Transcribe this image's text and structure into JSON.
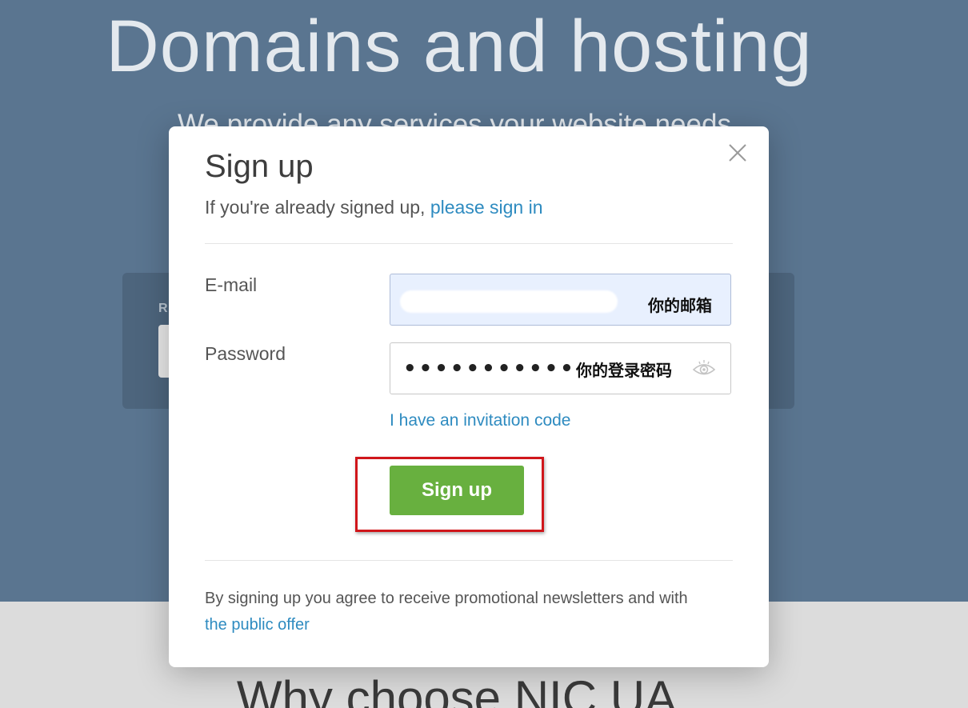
{
  "background": {
    "hero_title": "Domains and hosting",
    "hero_subtitle": "We provide any services your website needs",
    "search_label": "R",
    "lower_title": "Why choose NIC.UA"
  },
  "modal": {
    "title": "Sign up",
    "subtitle_prefix": "If you're already signed up, ",
    "signin_link": "please sign in",
    "email_label": "E-mail",
    "email_value": "",
    "email_annotation": "你的邮箱",
    "password_label": "Password",
    "password_value": "•••••••••••",
    "password_annotation": "你的登录密码",
    "invitation_link": "I have an invitation code",
    "signup_button": "Sign up",
    "footer_text": "By signing up you agree to receive promotional newsletters and with",
    "footer_link": "the public offer"
  },
  "icons": {
    "close": "close-icon",
    "password_visibility": "eye-icon"
  },
  "colors": {
    "hero_bg": "#5a7590",
    "link": "#2e8bc0",
    "button": "#68b03f",
    "highlight": "#d0161b",
    "email_autofill_bg": "#e8f0fe"
  }
}
